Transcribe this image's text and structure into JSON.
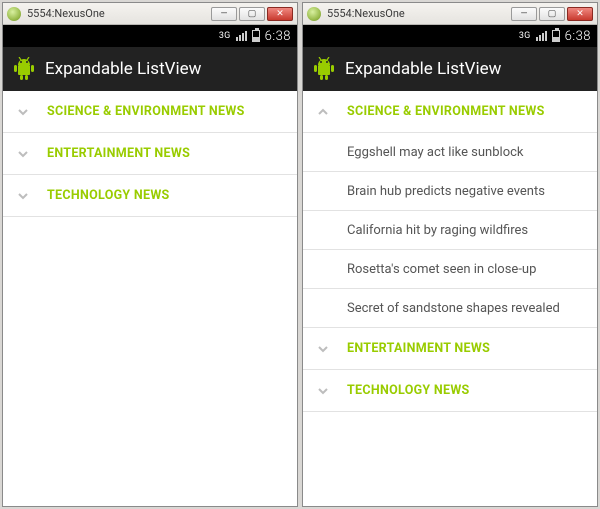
{
  "windowTitle": "5554:NexusOne",
  "statusbar": {
    "network": "3G",
    "time": "6:38"
  },
  "appTitle": "Expandable ListView",
  "emulators": [
    {
      "groups": [
        {
          "label": "SCIENCE & ENVIRONMENT NEWS",
          "expanded": false,
          "children": []
        },
        {
          "label": "ENTERTAINMENT NEWS",
          "expanded": false,
          "children": []
        },
        {
          "label": "TECHNOLOGY NEWS",
          "expanded": false,
          "children": []
        }
      ]
    },
    {
      "groups": [
        {
          "label": "SCIENCE & ENVIRONMENT NEWS",
          "expanded": true,
          "children": [
            "Eggshell may act like sunblock",
            "Brain hub predicts negative events",
            "California hit by raging wildfires",
            "Rosetta's comet seen in close-up",
            "Secret of sandstone shapes revealed"
          ]
        },
        {
          "label": "ENTERTAINMENT NEWS",
          "expanded": false,
          "children": []
        },
        {
          "label": "TECHNOLOGY NEWS",
          "expanded": false,
          "children": []
        }
      ]
    }
  ]
}
